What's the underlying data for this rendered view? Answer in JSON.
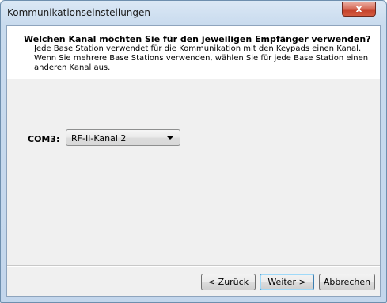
{
  "window": {
    "title": "Kommunikationseinstellungen",
    "close_glyph": "x"
  },
  "header": {
    "title": "Welchen Kanal möchten Sie für den jeweiligen Empfänger verwenden?",
    "description": "Jede Base Station verwendet für die Kommunikation mit den Keypads einen Kanal. Wenn Sie mehrere Base Stations verwenden, wählen Sie für jede Base Station einen anderen Kanal aus."
  },
  "channel": {
    "label": "COM3:",
    "selected": "RF-II-Kanal 2"
  },
  "buttons": {
    "back_prefix": "< ",
    "back_access": "Z",
    "back_rest": "urück",
    "next_access": "W",
    "next_rest": "eiter >",
    "cancel": "Abbrechen"
  },
  "colors": {
    "title_bar": "#c9dbee",
    "close_button": "#c4412b",
    "client_bg": "#f0f0f0",
    "header_bg": "#ffffff"
  },
  "icons": {
    "close": "close-icon",
    "dropdown": "chevron-down-icon"
  }
}
